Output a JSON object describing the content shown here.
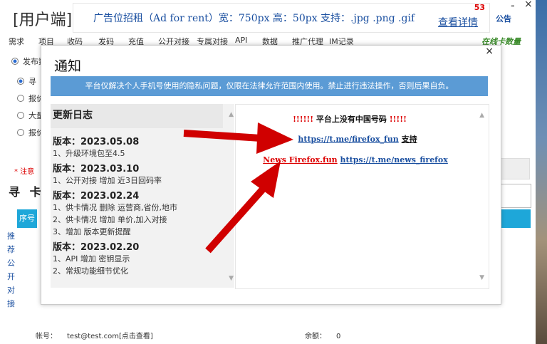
{
  "app": {
    "title": "[用户端]ht",
    "notice_link": "公告",
    "ad": {
      "text": "广告位招租（Ad for rent）宽：750px 高：50px 支持：.jpg .png .gif",
      "link": "查看详情",
      "count": "53"
    },
    "window_controls": {
      "minimize": "-",
      "close": "×"
    },
    "nav": [
      "需求",
      "项目",
      "收码",
      "发码",
      "充值",
      "公开对接",
      "专属对接",
      "API",
      "数据",
      "推广代理",
      "IM记录"
    ],
    "nav_right": "在线卡数量",
    "publish_label": "发布数",
    "options": [
      "寻",
      "报价",
      "大量",
      "报价"
    ],
    "warning": "* 注意",
    "find_card": "寻 卡",
    "seq_header": "序号",
    "vertical_label": [
      "推",
      "荐",
      "公",
      "开",
      "对",
      "接"
    ],
    "footer": {
      "account_label": "帐号：",
      "account_value": "test@test.com[点击查看]",
      "balance_label": "余额：",
      "balance_value": "0"
    }
  },
  "modal": {
    "title": "通知",
    "close": "×",
    "banner": "平台仅解决个人手机号使用的隐私问题，仅限在法律允许范围内使用。禁止进行违法操作，否则后果自负。",
    "changelog": {
      "title": "更新日志",
      "entries": [
        {
          "version": "版本：2023.05.08",
          "items": [
            "1、升级环境包至4.5"
          ]
        },
        {
          "version": "版本：2023.03.10",
          "items": [
            "1、公开对接 增加 近3日回码率"
          ]
        },
        {
          "version": "版本：2023.02.24",
          "items": [
            "1、供卡情况 删除 运营商,省份,地市",
            "2、供卡情况 增加 单价,加入对接",
            "3、增加 版本更新提醒"
          ]
        },
        {
          "version": "版本：2023.02.20",
          "items": [
            "1、API 增加 密钥显示",
            "2、常规功能细节优化"
          ]
        }
      ]
    },
    "right": {
      "line1_prefix": "!!!!!!",
      "line1_text": "平台上没有中国号码",
      "line1_suffix": "!!!!!",
      "link1": "https://t.me/firefox_fun",
      "link1_suffix": "支持",
      "link2_label": "News Firefox.fun",
      "link2": "https://t.me/news_firefox"
    }
  },
  "colors": {
    "banner": "#5b9bd5",
    "accent": "#1ea7d9",
    "warning": "#d00000",
    "link": "#1a4fa0",
    "arrow": "#d00000"
  }
}
